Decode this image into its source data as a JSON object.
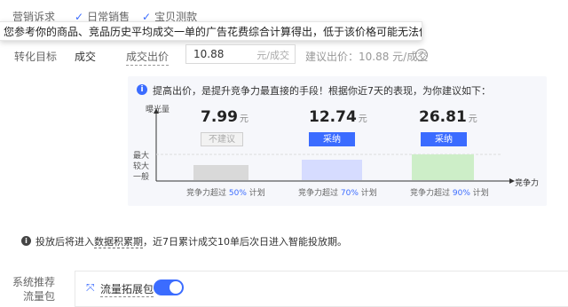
{
  "tabs": [
    {
      "label": "营销诉求",
      "checked": false
    },
    {
      "label": "日常销售",
      "checked": true
    },
    {
      "label": "宝贝测款",
      "checked": true
    }
  ],
  "tooltip_text": "您参考你的商品、竞品历史平均成交一单的广告花费综合计算得出，低于该价格可能无法保证投放效果",
  "conversion": {
    "label": "转化目标",
    "value": "成交"
  },
  "bid": {
    "label": "成交出价",
    "value": "10.88",
    "unit": "元/成交"
  },
  "suggest": {
    "text": "建议出价：10.88 元/成交",
    "help_icon": "question-circle-icon"
  },
  "panel": {
    "info_icon": "info-circle-icon",
    "message": "提高出价，是提升竞争力最直接的手段！根据你近7天的表现，为你建议如下：",
    "y_axis_title": "曝光量",
    "y_levels": [
      "最大",
      "较大",
      "一般"
    ],
    "x_axis_title": "竞争力",
    "options": [
      {
        "price": "7.99",
        "unit": "元",
        "button": "不建议",
        "button_style": "disabled",
        "caption_prefix": "竞争力超过",
        "percent": "50%",
        "caption_suffix": "计划",
        "level": 1,
        "bar_color": "#d9d9d9"
      },
      {
        "price": "12.74",
        "unit": "元",
        "button": "采纳",
        "button_style": "primary",
        "caption_prefix": "竞争力超过",
        "percent": "70%",
        "caption_suffix": "计划",
        "level": 2,
        "bar_color": "#d6dcff"
      },
      {
        "price": "26.81",
        "unit": "元",
        "button": "采纳",
        "button_style": "primary",
        "caption_prefix": "竞争力超过",
        "percent": "90%",
        "caption_suffix": "计划",
        "level": 3,
        "bar_color": "#cdeec8"
      }
    ]
  },
  "note": {
    "icon": "info-circle-icon",
    "prefix": "投放后将进入",
    "link": "数据积累期",
    "suffix": "，近7日累计成交10单后次日进入智能投放期。"
  },
  "system_recommend": {
    "label_line1": "系统推荐",
    "label_line2": "流量包",
    "pack_icon": "expand-arrows-icon",
    "pack_label": "流量拓展包",
    "enabled": true
  }
}
